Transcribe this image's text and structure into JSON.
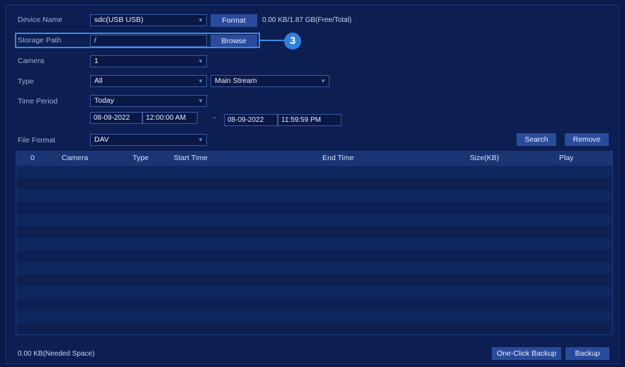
{
  "form": {
    "device_name": {
      "label": "Device Name",
      "value": "sdc(USB USB)",
      "format_button": "Format",
      "capacity": "0.00 KB/1.87 GB(Free/Total)"
    },
    "storage_path": {
      "label": "Storage Path",
      "value": "/",
      "browse_button": "Browse"
    },
    "camera": {
      "label": "Camera",
      "value": "1"
    },
    "type": {
      "label": "Type",
      "value": "All",
      "stream": "Main Stream"
    },
    "time_period": {
      "label": "Time Period",
      "value": "Today",
      "start_date": "08-09-2022",
      "start_time": "12:00:00 AM",
      "separator": "-",
      "end_date": "08-09-2022",
      "end_time": "11:59:59 PM"
    },
    "file_format": {
      "label": "File Format",
      "value": "DAV"
    }
  },
  "actions": {
    "search": "Search",
    "remove": "Remove"
  },
  "callout": {
    "number": "3"
  },
  "table": {
    "columns": [
      "0",
      "Camera",
      "Type",
      "Start Time",
      "End Time",
      "Size(KB)",
      "Play"
    ],
    "row_count": 14
  },
  "footer": {
    "needed_space": "0.00 KB(Needed Space)",
    "one_click_backup": "One-Click Backup",
    "backup": "Backup"
  },
  "colors": {
    "background": "#0a1a4a",
    "accent": "#2f7fe0",
    "button": "#2a4b9b"
  }
}
